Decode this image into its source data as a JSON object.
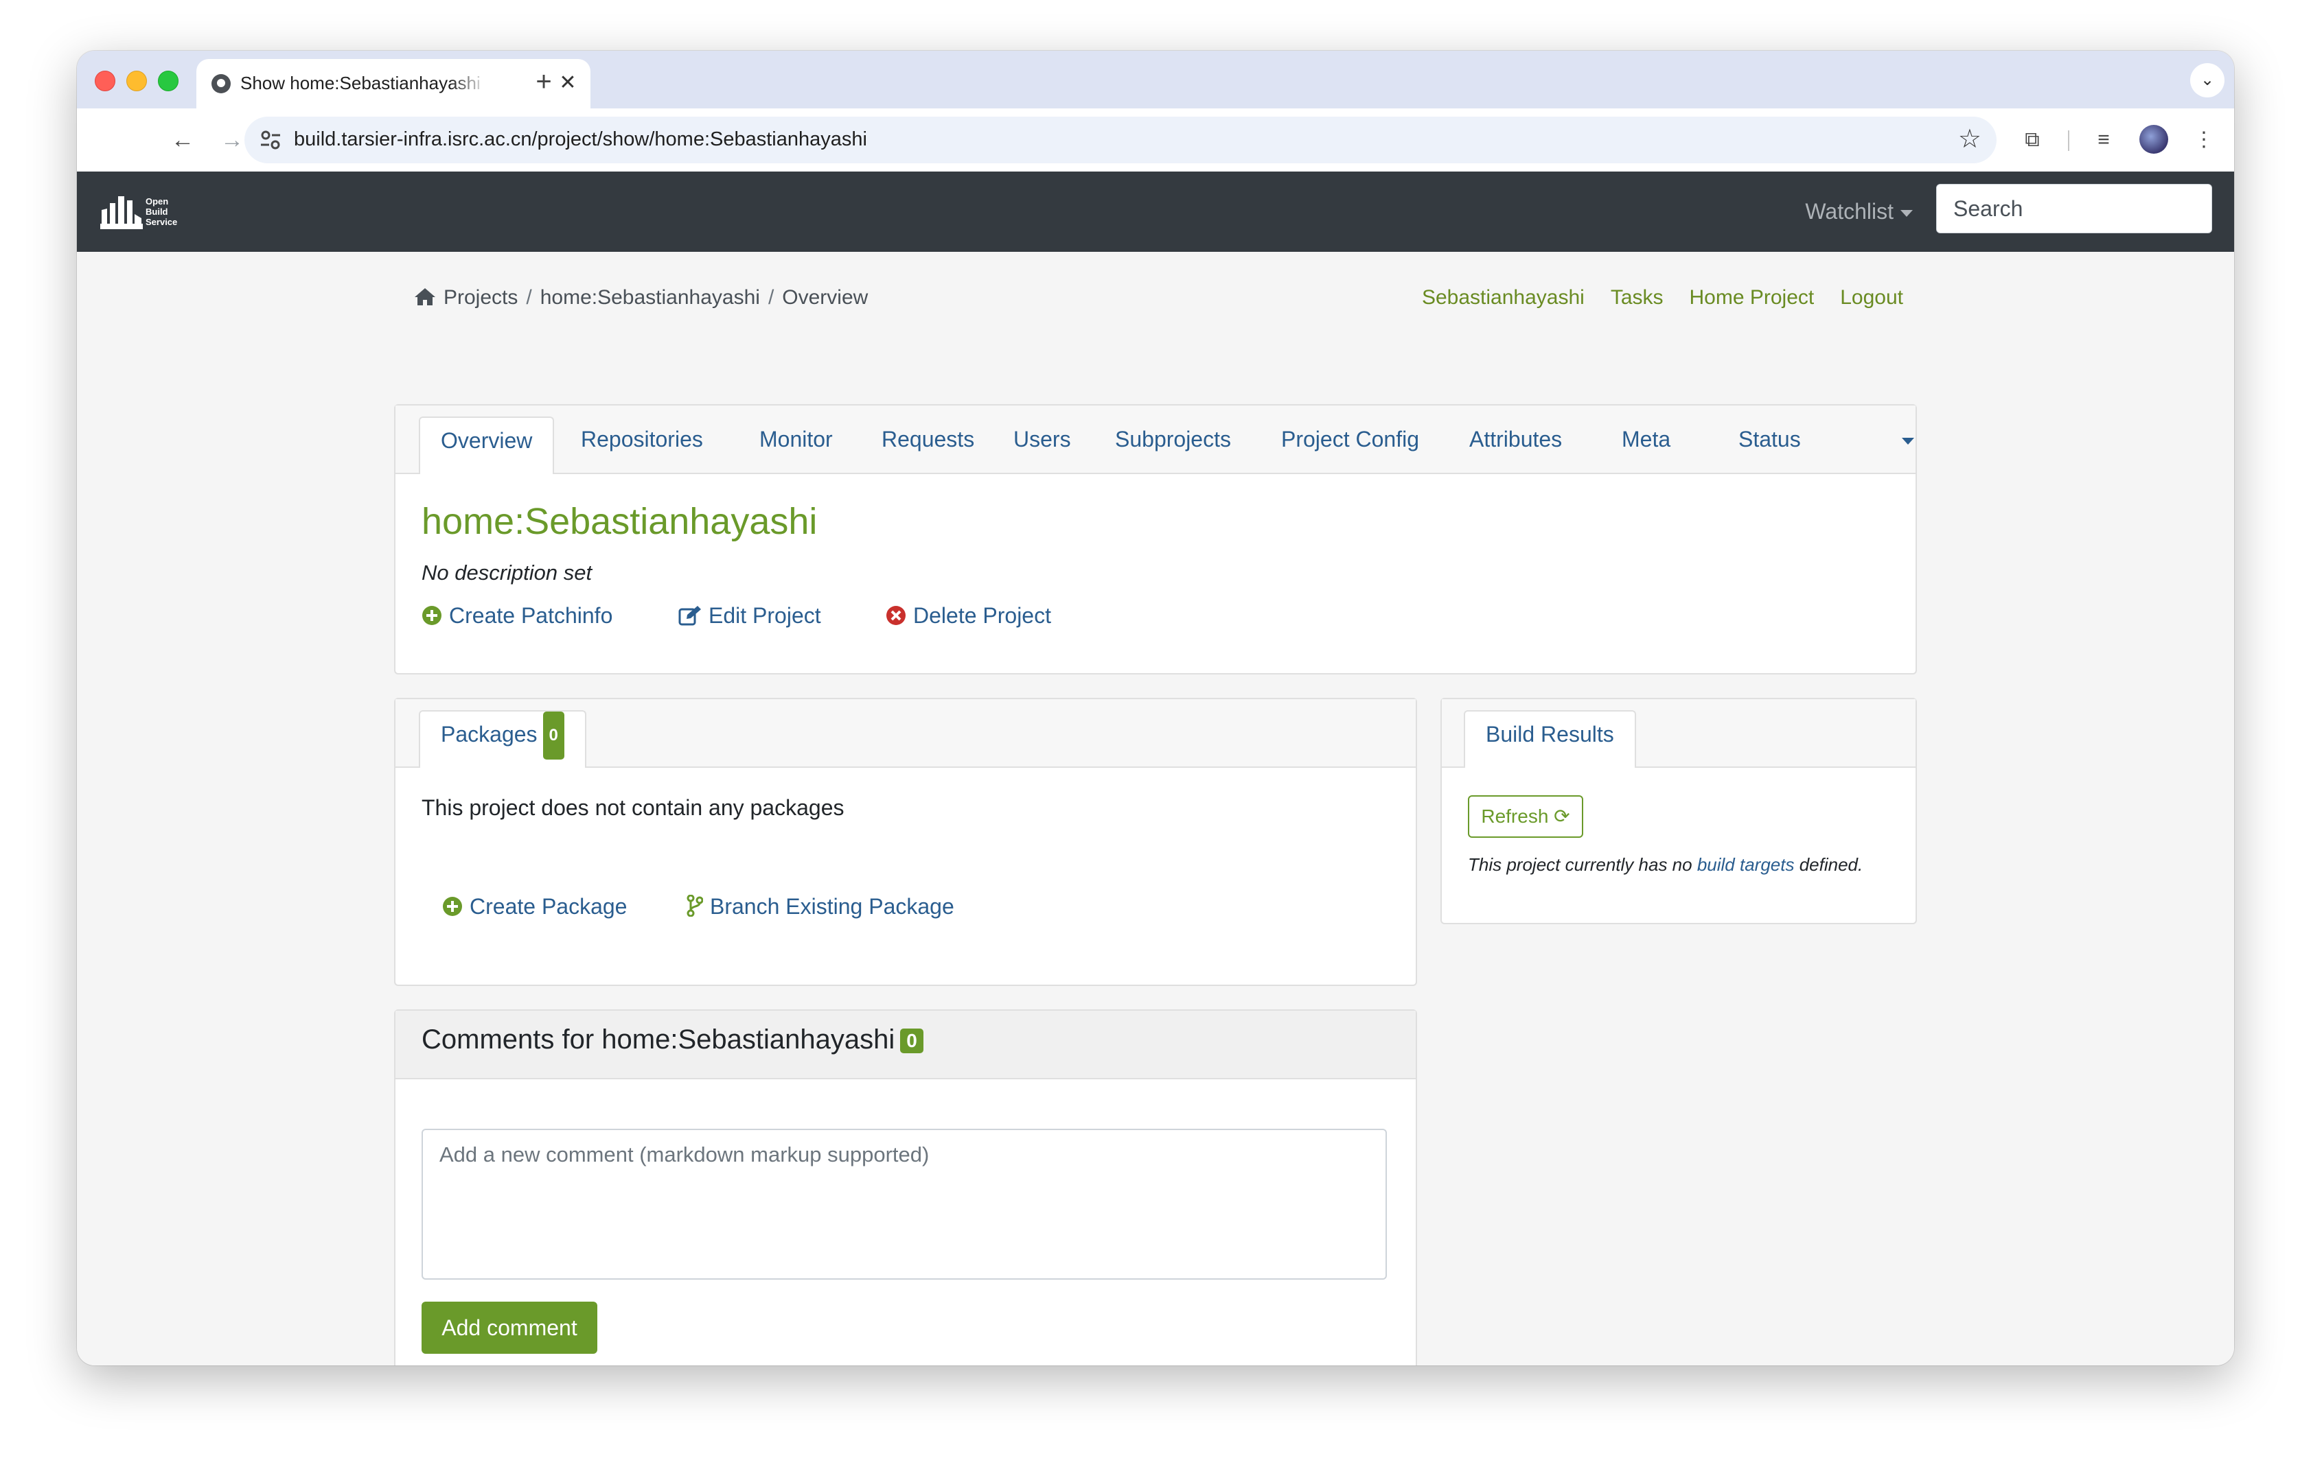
{
  "browser": {
    "tab_title": "Show home:Sebastianhayashi",
    "url": "build.tarsier-infra.isrc.ac.cn/project/show/home:Sebastianhayashi"
  },
  "navbar": {
    "logo_lines": [
      "Open",
      "Build",
      "Service"
    ],
    "watchlist_label": "Watchlist",
    "search_placeholder": "Search"
  },
  "breadcrumb": {
    "items": [
      "Projects",
      "home:Sebastianhayashi",
      "Overview"
    ]
  },
  "user_links": [
    "Sebastianhayashi",
    "Tasks",
    "Home Project",
    "Logout"
  ],
  "project_tabs": [
    "Overview",
    "Repositories",
    "Monitor",
    "Requests",
    "Users",
    "Subprojects",
    "Project Config",
    "Attributes",
    "Meta",
    "Status"
  ],
  "project": {
    "title": "home:Sebastianhayashi",
    "description": "No description set",
    "actions": [
      "Create Patchinfo",
      "Edit Project",
      "Delete Project"
    ]
  },
  "packages": {
    "tab_label": "Packages",
    "count": "0",
    "empty_text": "This project does not contain any packages",
    "actions": [
      "Create Package",
      "Branch Existing Package"
    ]
  },
  "build_results": {
    "tab_label": "Build Results",
    "refresh_label": "Refresh",
    "note_prefix": "This project currently has no",
    "note_link": "build targets",
    "note_suffix": "defined."
  },
  "comments": {
    "title": "Comments for home:Sebastianhayashi",
    "count": "0",
    "placeholder": "Add a new comment (markdown markup supported)",
    "submit_label": "Add comment"
  },
  "colors": {
    "navbar_bg": "#343a40",
    "accent_green": "#6a9a2a",
    "link_blue": "#2a5d8f"
  }
}
